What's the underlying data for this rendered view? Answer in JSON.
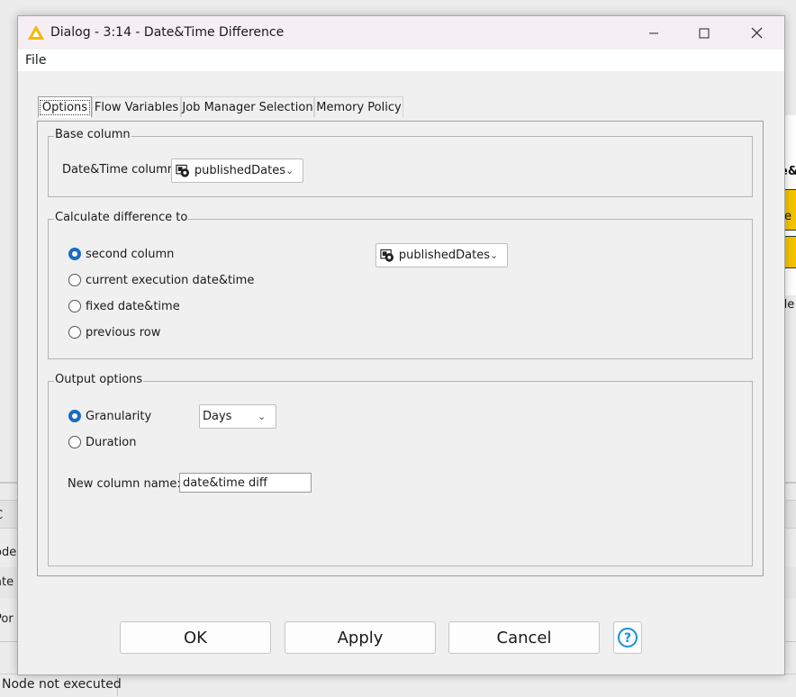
{
  "background": {
    "status": "Node not executed",
    "left_texts": [
      "C",
      "ode",
      "ate",
      "Por"
    ],
    "right_texts": [
      "e&",
      "re",
      "de"
    ]
  },
  "dialog": {
    "title": "Dialog - 3:14 - Date&Time Difference",
    "menu": {
      "file": "File"
    },
    "tabs": [
      "Options",
      "Flow Variables",
      "Job Manager Selection",
      "Memory Policy"
    ],
    "active_tab": "Options",
    "base_column": {
      "group_title": "Base column",
      "label": "Date&Time column",
      "value": "publishedDates"
    },
    "calc_diff": {
      "group_title": "Calculate difference to",
      "options": [
        "second column",
        "current execution date&time",
        "fixed date&time",
        "previous row"
      ],
      "selected": "second column",
      "second_column_value": "publishedDates"
    },
    "output": {
      "group_title": "Output options",
      "options": [
        "Granularity",
        "Duration"
      ],
      "selected": "Granularity",
      "granularity_value": "Days",
      "new_col_label": "New column name:",
      "new_col_value": "date&time diff"
    },
    "buttons": {
      "ok": "OK",
      "apply": "Apply",
      "cancel": "Cancel",
      "help": "?"
    }
  },
  "colors": {
    "accent": "#1a6dbf",
    "warning": "#f5b800",
    "titlebar": "#f5eef3"
  }
}
